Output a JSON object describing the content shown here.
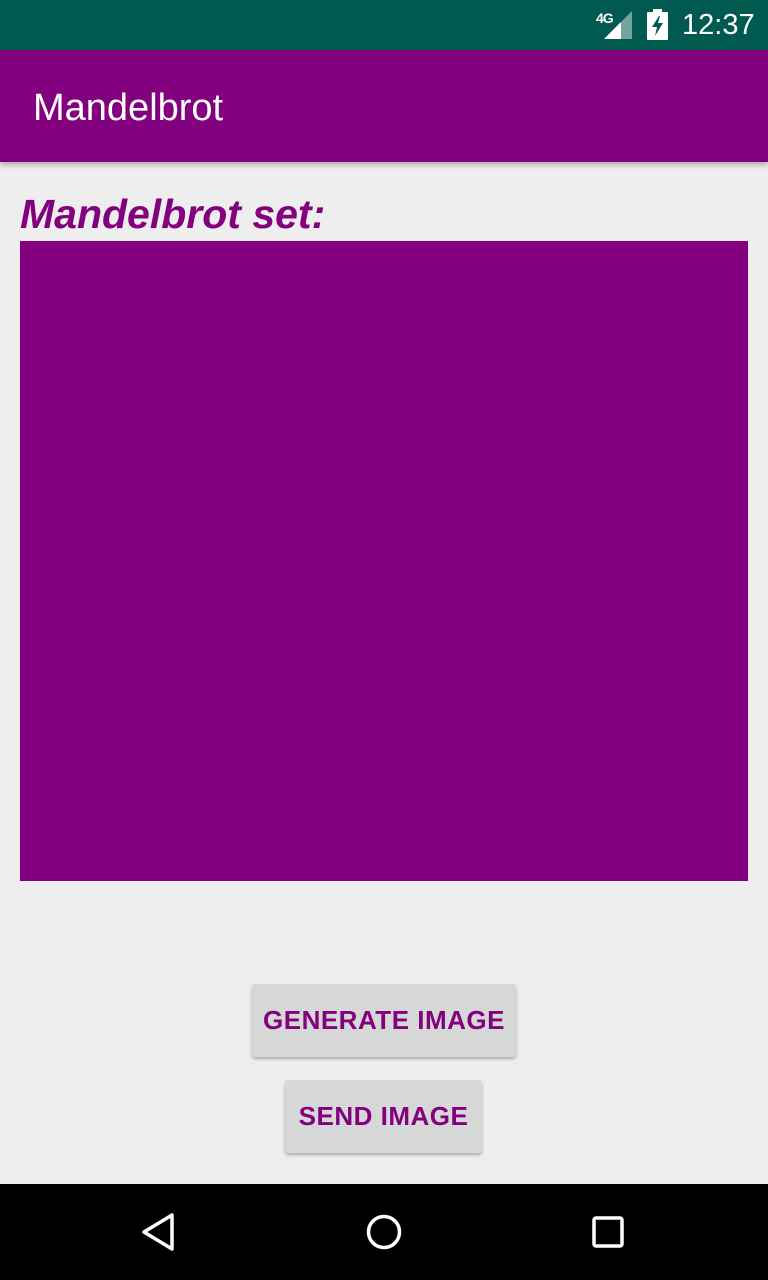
{
  "status_bar": {
    "network": "4G",
    "time": "12:37",
    "icons": [
      "signal-icon",
      "battery-charging-icon"
    ]
  },
  "app_bar": {
    "title": "Mandelbrot"
  },
  "content": {
    "heading": "Mandelbrot set:",
    "image_color": "#83007e"
  },
  "buttons": {
    "generate_label": "GENERATE IMAGE",
    "send_label": "SEND IMAGE"
  },
  "nav_bar": {
    "icons": [
      "back-icon",
      "home-icon",
      "recents-icon"
    ]
  },
  "colors": {
    "status_bar": "#005a4f",
    "primary": "#83007e",
    "background": "#eeeeee",
    "button": "#d6d7d7"
  }
}
